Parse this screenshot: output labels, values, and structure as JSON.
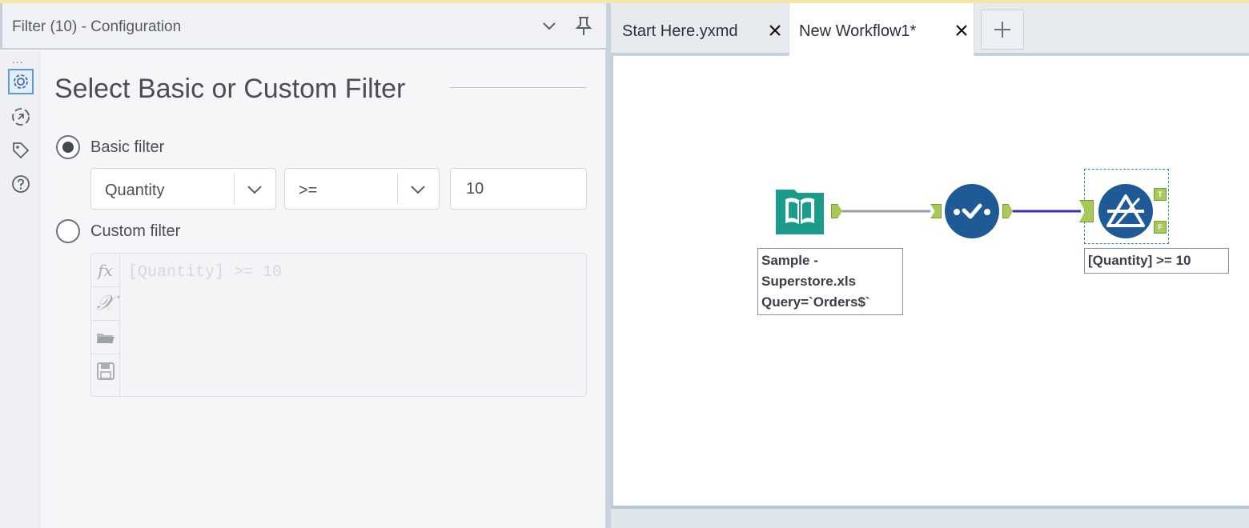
{
  "config": {
    "title": "Filter (10) - Configuration",
    "section_title": "Select Basic or Custom Filter",
    "basic_filter_label": "Basic filter",
    "custom_filter_label": "Custom filter",
    "field_select_value": "Quantity",
    "operator_select_value": ">=",
    "value_input": "10",
    "expression_placeholder": "[Quantity] >= 10",
    "rail_dots": "...",
    "basic_selected": true
  },
  "tabs": [
    {
      "label": "Start Here.yxmd",
      "close_icon": "close-icon"
    },
    {
      "label": "New Workflow1*",
      "close_icon": "close-icon",
      "active": true
    }
  ],
  "canvas": {
    "input_label": [
      "Sample -",
      "Superstore.xls",
      "Query=`Orders$`"
    ],
    "filter_label": "[Quantity] >= 10",
    "true_anchor": "T",
    "false_anchor": "F"
  },
  "colors": {
    "tool_blue": "#1e5a96",
    "input_teal": "#1a9b8b",
    "anchor_green": "#a8c857",
    "connection_purple": "#3b2fb0",
    "connection_gray": "#9a9ea5"
  }
}
